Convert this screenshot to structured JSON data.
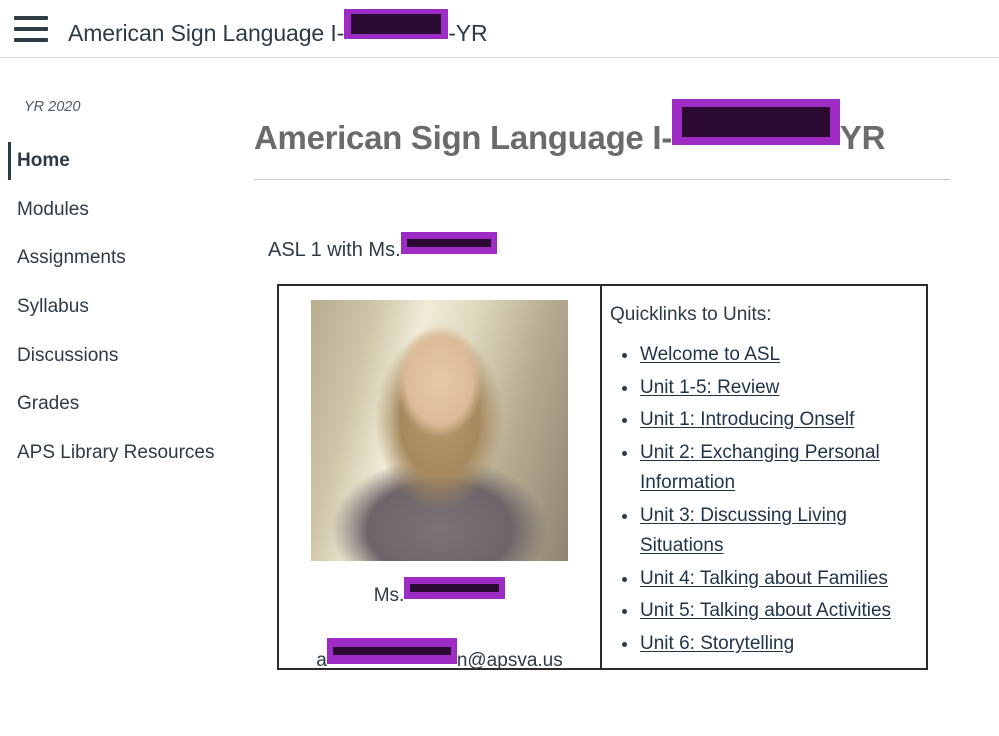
{
  "topbar": {
    "menu_icon": "hamburger-menu-icon",
    "title_prefix": "American Sign Language I-",
    "title_redacted": "[REDACTED]",
    "title_suffix": "-YR"
  },
  "sidebar": {
    "term": "YR 2020",
    "items": [
      {
        "label": "Home",
        "active": true
      },
      {
        "label": "Modules",
        "active": false
      },
      {
        "label": "Assignments",
        "active": false
      },
      {
        "label": "Syllabus",
        "active": false
      },
      {
        "label": "Discussions",
        "active": false
      },
      {
        "label": "Grades",
        "active": false
      },
      {
        "label": "APS Library Resources",
        "active": false
      }
    ]
  },
  "main": {
    "page_title_prefix": "American Sign Language I-",
    "page_title_redacted": "[REDACTED]",
    "page_title_suffix": "YR",
    "intro_prefix": "ASL 1 with Ms.",
    "intro_redacted": "[REDACTED]",
    "teacher": {
      "photo_alt": "teacher-portrait-photo",
      "name_prefix": "Ms.",
      "name_redacted": "[REDACTED]",
      "email_prefix": "a",
      "email_redacted": "[REDACTED]",
      "email_suffix": "n@apsva.us"
    },
    "quicklinks": {
      "heading": "Quicklinks to Units:",
      "items": [
        "Welcome to ASL",
        "Unit 1-5: Review",
        "Unit 1: Introducing Onself",
        "Unit 2: Exchanging Personal Information",
        "Unit 3: Discussing Living Situations",
        "Unit 4: Talking about Families",
        "Unit 5: Talking about Activities",
        "Unit 6: Storytelling"
      ]
    }
  },
  "colors": {
    "redaction_border": "#9d2bc4",
    "redaction_fill": "#2a0a33",
    "text_primary": "#2d3b45",
    "title_gray": "#6b6b6b",
    "link": "#1f3349"
  }
}
